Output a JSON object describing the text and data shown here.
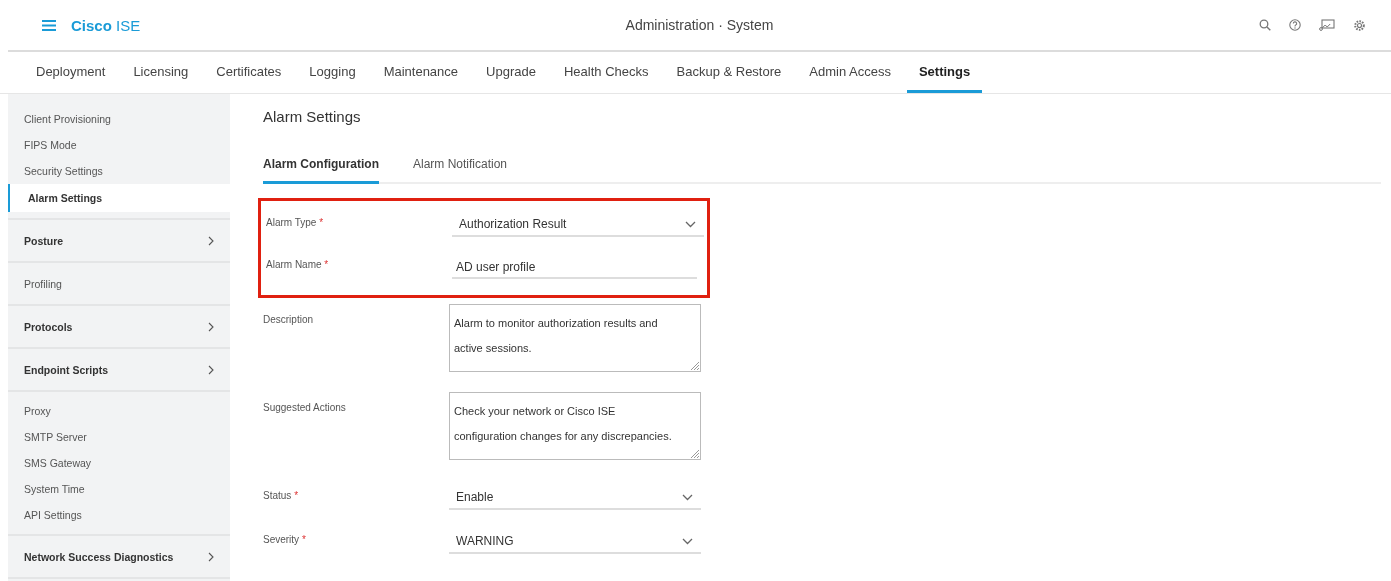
{
  "header": {
    "brand_bold": "Cisco",
    "brand_rest": "ISE",
    "title": "Administration · System"
  },
  "top_tabs": [
    {
      "label": "Deployment",
      "selected": false
    },
    {
      "label": "Licensing",
      "selected": false
    },
    {
      "label": "Certificates",
      "selected": false
    },
    {
      "label": "Logging",
      "selected": false
    },
    {
      "label": "Maintenance",
      "selected": false
    },
    {
      "label": "Upgrade",
      "selected": false
    },
    {
      "label": "Health Checks",
      "selected": false
    },
    {
      "label": "Backup & Restore",
      "selected": false
    },
    {
      "label": "Admin Access",
      "selected": false
    },
    {
      "label": "Settings",
      "selected": true
    }
  ],
  "sidebar": {
    "sections": [
      [
        {
          "label": "Client Provisioning",
          "expandable": false,
          "selected": false
        },
        {
          "label": "FIPS Mode",
          "expandable": false,
          "selected": false
        },
        {
          "label": "Security Settings",
          "expandable": false,
          "selected": false
        },
        {
          "label": "Alarm Settings",
          "expandable": false,
          "selected": true
        }
      ],
      [
        {
          "label": "Posture",
          "expandable": true,
          "selected": false
        }
      ],
      [
        {
          "label": "Profiling",
          "expandable": false,
          "selected": false
        }
      ],
      [
        {
          "label": "Protocols",
          "expandable": true,
          "selected": false
        }
      ],
      [
        {
          "label": "Endpoint Scripts",
          "expandable": true,
          "selected": false
        }
      ],
      [
        {
          "label": "Proxy",
          "expandable": false,
          "selected": false
        },
        {
          "label": "SMTP Server",
          "expandable": false,
          "selected": false
        },
        {
          "label": "SMS Gateway",
          "expandable": false,
          "selected": false
        },
        {
          "label": "System Time",
          "expandable": false,
          "selected": false
        },
        {
          "label": "API Settings",
          "expandable": false,
          "selected": false
        }
      ],
      [
        {
          "label": "Network Success Diagnostics",
          "expandable": true,
          "selected": false
        }
      ]
    ]
  },
  "page_title": "Alarm Settings",
  "sub_tabs": [
    {
      "label": "Alarm Configuration",
      "selected": true
    },
    {
      "label": "Alarm Notification",
      "selected": false
    }
  ],
  "form": {
    "highlighted_fields": [
      {
        "kind": "select",
        "label": "Alarm Type",
        "required_mark": "*",
        "value": "Authorization Result"
      },
      {
        "kind": "text",
        "label": "Alarm Name",
        "required_mark": "*",
        "value": "AD user profile"
      }
    ],
    "fields": [
      {
        "kind": "textarea",
        "label": "Description",
        "value": "Alarm to monitor authorization results and active sessions."
      },
      {
        "kind": "textarea",
        "label": "Suggested Actions",
        "value": "Check your network or Cisco ISE configuration changes for any discrepancies."
      },
      {
        "kind": "select",
        "label": "Status",
        "required_mark": "*",
        "value": "Enable"
      },
      {
        "kind": "select",
        "label": "Severity",
        "required_mark": "*",
        "value": "WARNING"
      }
    ]
  }
}
